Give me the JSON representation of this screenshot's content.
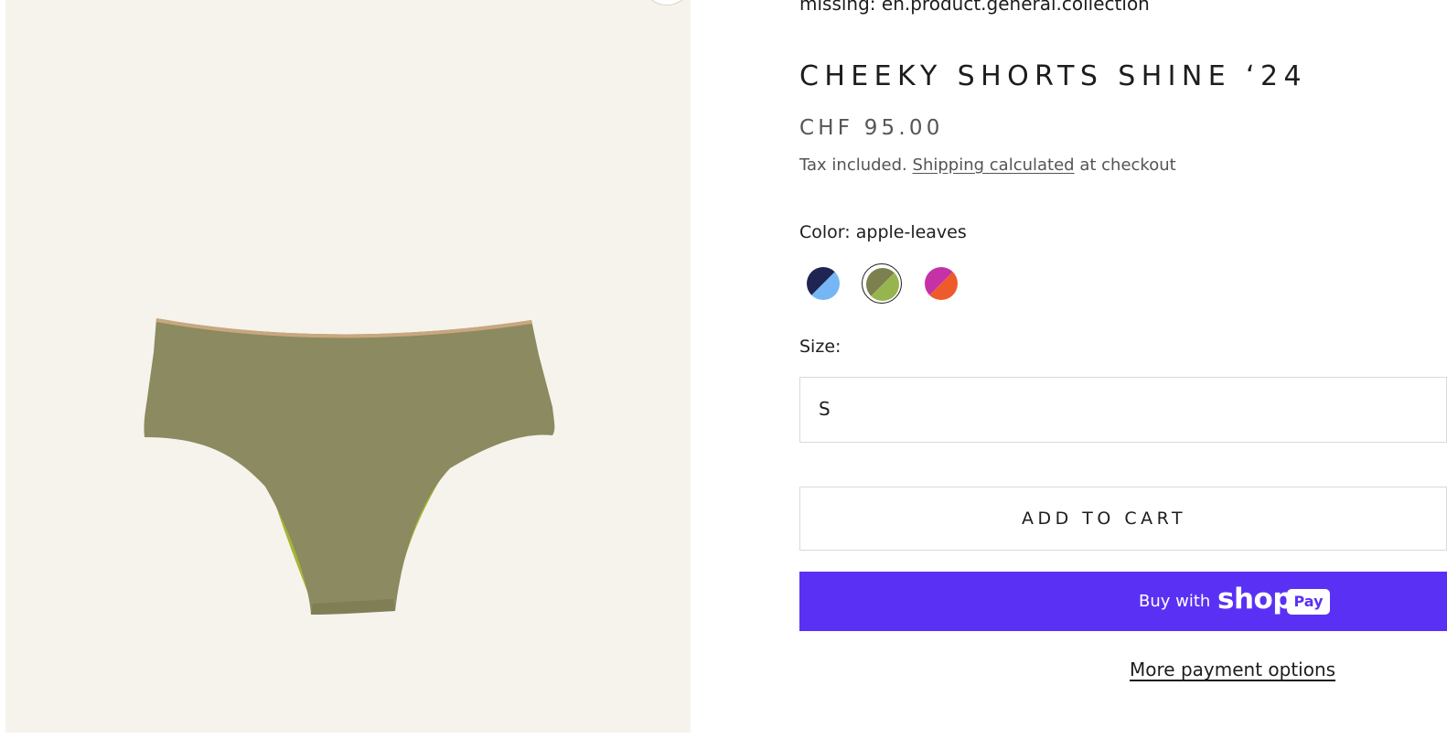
{
  "product": {
    "collection_text": "missing: en.product.general.collection",
    "title": "CHEEKY SHORTS SHINE ‘24",
    "price": "CHF 95.00",
    "tax_prefix": "Tax included.",
    "shipping_link": "Shipping calculated",
    "tax_suffix": "at checkout",
    "image_alt": "Cheeky Shorts Shine ‘24 in apple-leaves"
  },
  "color": {
    "label": "Color:",
    "selected": "apple-leaves",
    "swatches": [
      {
        "name": "navy-sky",
        "color_a": "#1f2452",
        "color_b": "#74b7f4",
        "selected": false
      },
      {
        "name": "apple-leaves",
        "color_a": "#7c7f4e",
        "color_b": "#97b54e",
        "selected": true
      },
      {
        "name": "magenta-orange",
        "color_a": "#c531a6",
        "color_b": "#ee5a2c",
        "selected": false
      }
    ]
  },
  "size": {
    "label": "Size:",
    "value": "S"
  },
  "actions": {
    "add_to_cart": "ADD TO CART",
    "buy_with": "Buy with",
    "shop_word": "shop",
    "pay_badge": "Pay",
    "more_payment": "More payment options"
  },
  "colors": {
    "image_bg": "#f6f3ed",
    "garment": "#8b8a60",
    "garment_lining": "#a7b433",
    "shop_pay": "#5a31f4"
  }
}
